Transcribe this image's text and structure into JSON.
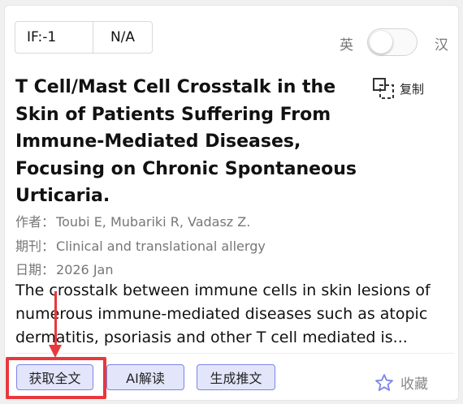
{
  "header": {
    "if_label": "IF:-1",
    "category": "N/A",
    "lang_en": "英",
    "lang_zh": "汉",
    "toggle_state": "off"
  },
  "article": {
    "title": "T Cell/Mast Cell Crosstalk in the Skin of Patients Suffering From Immune-Mediated Diseases, Focusing on Chronic Spontaneous Urticaria.",
    "copy_label": "复制",
    "authors_label": "作者：",
    "authors": "Toubi E, Mubariki R, Vadasz Z.",
    "journal_label": "期刊：",
    "journal": "Clinical and translational allergy",
    "date_label": "日期：",
    "date": "2026 Jan",
    "abstract": "The crosstalk between immune cells in skin lesions of numerous immune-mediated diseases such as atopic dermatitis, psoriasis and other T cell mediated is..."
  },
  "actions": {
    "get_fulltext": "获取全文",
    "ai_read": "AI解读",
    "generate_tweet": "生成推文",
    "favorite": "收藏"
  },
  "colors": {
    "accent_border": "#7b86e4",
    "button_bg": "#e3e6fb",
    "annotation_red": "#e8383d"
  }
}
